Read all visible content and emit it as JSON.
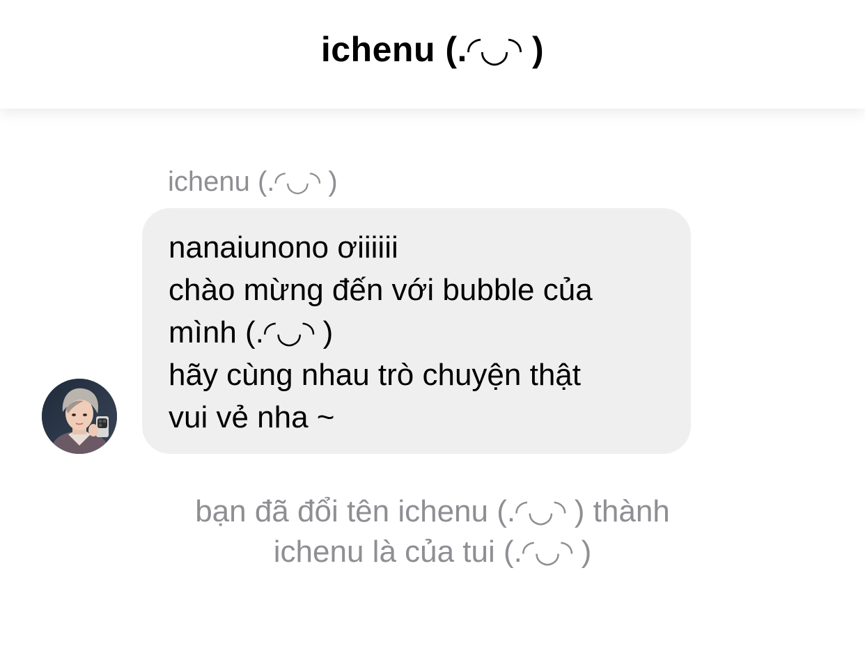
{
  "header": {
    "title": "ichenu (.◜◡◝ )"
  },
  "conversation": {
    "sender_name": "ichenu (.◜◡◝ )",
    "avatar_icon": "profile-photo",
    "message_lines": [
      "nanaiunono ơiiiiii",
      "chào mừng đến với bubble của",
      "mình (.◜◡◝ )",
      "hãy cùng nhau trò chuyện thật",
      "vui vẻ nha ~"
    ],
    "system_note": {
      "line1": "bạn đã đổi tên ichenu (.◜◡◝ ) thành",
      "line2": "ichenu là của tui (.◜◡◝ )"
    }
  },
  "colors": {
    "bubble": "#efefef",
    "secondary_text": "#8e8e93",
    "primary_text": "#000000"
  }
}
